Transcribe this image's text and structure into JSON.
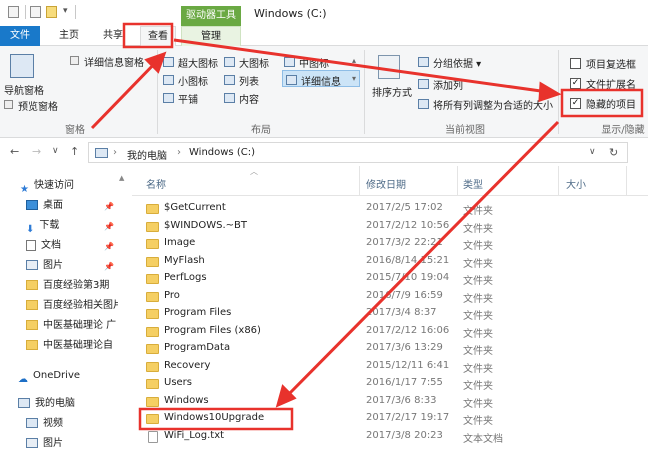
{
  "titlebar": {
    "context_tab": "驱动器工具",
    "window_title": "Windows (C:)"
  },
  "tabs": {
    "file": "文件",
    "home": "主页",
    "share": "共享",
    "view": "查看",
    "manage": "管理"
  },
  "ribbon": {
    "panes": {
      "nav_pane": "导航窗格",
      "preview_pane": "预览窗格",
      "details_pane": "详细信息窗格",
      "label": "窗格"
    },
    "layout": {
      "extra_large": "超大图标",
      "large": "大图标",
      "medium": "中图标",
      "small": "小图标",
      "list": "列表",
      "details": "详细信息",
      "tiles": "平铺",
      "content": "内容",
      "label": "布局"
    },
    "current_view": {
      "sort": "排序方式",
      "group": "分组依据 ▾",
      "add_columns": "添加列",
      "fit_columns": "将所有列调整为合适的大小",
      "label": "当前视图"
    },
    "show_hide": {
      "item_checkboxes": "项目复选框",
      "file_extensions": "文件扩展名",
      "hidden_items": "隐藏的项目",
      "label": "显示/隐藏",
      "item_checkboxes_checked": false,
      "file_extensions_checked": true,
      "hidden_items_checked": true
    }
  },
  "navbar": {
    "back": "←",
    "forward": "→",
    "recent": "∨",
    "up": "↑",
    "crumbs": [
      "我的电脑",
      "Windows (C:)"
    ],
    "separator": "›",
    "dropdown": "∨",
    "refresh": "↻"
  },
  "sidebar": {
    "items": [
      {
        "label": "快速访问",
        "icon": "star-icon"
      },
      {
        "label": "桌面",
        "icon": "desktop-icon"
      },
      {
        "label": "下载",
        "icon": "download-icon"
      },
      {
        "label": "文档",
        "icon": "document-icon"
      },
      {
        "label": "图片",
        "icon": "picture-icon"
      },
      {
        "label": "百度经验第3期",
        "icon": "folder-icon"
      },
      {
        "label": "百度经验相关图片",
        "icon": "folder-icon"
      },
      {
        "label": "中医基础理论 广",
        "icon": "folder-icon"
      },
      {
        "label": "中医基础理论自",
        "icon": "folder-icon"
      },
      {
        "label": "OneDrive",
        "icon": "cloud-icon"
      },
      {
        "label": "我的电脑",
        "icon": "computer-icon"
      },
      {
        "label": "视频",
        "icon": "video-icon"
      },
      {
        "label": "图片",
        "icon": "picture-icon"
      }
    ]
  },
  "filelist": {
    "columns": {
      "name": "名称",
      "date": "修改日期",
      "type": "类型",
      "size": "大小"
    },
    "rows": [
      {
        "name": "$GetCurrent",
        "date": "2017/2/5 17:02",
        "type": "文件夹",
        "kind": "folder"
      },
      {
        "name": "$WINDOWS.~BT",
        "date": "2017/2/12 10:56",
        "type": "文件夹",
        "kind": "folder"
      },
      {
        "name": "Image",
        "date": "2017/3/2 22:21",
        "type": "文件夹",
        "kind": "folder"
      },
      {
        "name": "MyFlash",
        "date": "2016/8/14 15:21",
        "type": "文件夹",
        "kind": "folder"
      },
      {
        "name": "PerfLogs",
        "date": "2015/7/10 19:04",
        "type": "文件夹",
        "kind": "folder"
      },
      {
        "name": "Pro",
        "date": "2016/7/9 16:59",
        "type": "文件夹",
        "kind": "folder"
      },
      {
        "name": "Program Files",
        "date": "2017/3/4 8:37",
        "type": "文件夹",
        "kind": "folder"
      },
      {
        "name": "Program Files (x86)",
        "date": "2017/2/12 16:06",
        "type": "文件夹",
        "kind": "folder"
      },
      {
        "name": "ProgramData",
        "date": "2017/3/6 13:29",
        "type": "文件夹",
        "kind": "folder"
      },
      {
        "name": "Recovery",
        "date": "2015/12/11 6:41",
        "type": "文件夹",
        "kind": "folder"
      },
      {
        "name": "Users",
        "date": "2016/1/17 7:55",
        "type": "文件夹",
        "kind": "folder"
      },
      {
        "name": "Windows",
        "date": "2017/3/6 8:33",
        "type": "文件夹",
        "kind": "folder"
      },
      {
        "name": "Windows10Upgrade",
        "date": "2017/2/17 19:17",
        "type": "文件夹",
        "kind": "folder"
      },
      {
        "name": "WiFi_Log.txt",
        "date": "2017/3/8 20:23",
        "type": "文本文档",
        "kind": "file"
      }
    ]
  },
  "colors": {
    "accent": "#1979ca",
    "context_tab": "#6aa943",
    "annotation": "#e8322c",
    "folder": "#f5cf63"
  }
}
